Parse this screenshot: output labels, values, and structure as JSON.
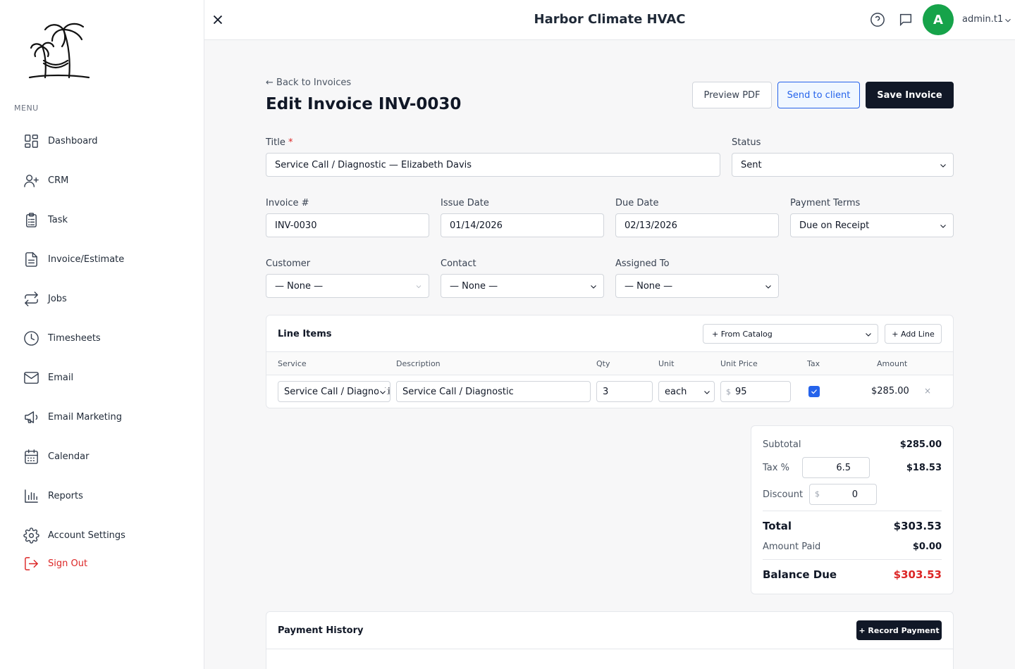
{
  "app": {
    "title": "Harbor Climate HVAC"
  },
  "user": {
    "initial": "A",
    "name": "admin.t1"
  },
  "sidebar": {
    "menu_label": "MENU",
    "items": [
      {
        "label": "Dashboard",
        "icon": "grid-icon"
      },
      {
        "label": "CRM",
        "icon": "user-plus-icon"
      },
      {
        "label": "Task",
        "icon": "clipboard-icon"
      },
      {
        "label": "Invoice/Estimate",
        "icon": "document-icon"
      },
      {
        "label": "Jobs",
        "icon": "repeat-arrows-icon"
      },
      {
        "label": "Timesheets",
        "icon": "clock-icon"
      },
      {
        "label": "Email",
        "icon": "envelope-icon"
      },
      {
        "label": "Email Marketing",
        "icon": "megaphone-icon"
      },
      {
        "label": "Calendar",
        "icon": "calendar-icon"
      },
      {
        "label": "Reports",
        "icon": "bar-chart-icon"
      },
      {
        "label": "Account Settings",
        "icon": "gear-icon"
      }
    ],
    "sign_out": "Sign Out"
  },
  "header": {
    "back_link": "← Back to Invoices",
    "page_title": "Edit Invoice INV-0030",
    "preview_pdf": "Preview PDF",
    "send_to_client": "Send to client",
    "save_invoice": "Save Invoice"
  },
  "form": {
    "title_label": "Title",
    "title_required": "*",
    "title_value": "Service Call / Diagnostic — Elizabeth Davis",
    "status_label": "Status",
    "status_value": "Sent",
    "invoice_no_label": "Invoice #",
    "invoice_no_value": "INV-0030",
    "issue_date_label": "Issue Date",
    "issue_date_value": "01/14/2026",
    "due_date_label": "Due Date",
    "due_date_value": "02/13/2026",
    "payment_terms_label": "Payment Terms",
    "payment_terms_value": "Due on Receipt",
    "customer_label": "Customer",
    "customer_value": "— None —",
    "contact_label": "Contact",
    "contact_value": "— None —",
    "assigned_label": "Assigned To",
    "assigned_value": "— None —"
  },
  "line_items": {
    "title": "Line Items",
    "from_catalog": "+ From Catalog",
    "add_line": "+ Add Line",
    "columns": [
      "Service",
      "Description",
      "Qty",
      "Unit",
      "Unit Price",
      "Tax",
      "Amount"
    ],
    "rows": [
      {
        "service": "Service Call / Diagnostic",
        "description": "Service Call / Diagnostic",
        "qty": "3",
        "unit": "each",
        "currency": "$",
        "unit_price": "95",
        "tax": true,
        "amount": "$285.00",
        "remove": "×"
      }
    ]
  },
  "totals": {
    "subtotal_label": "Subtotal",
    "subtotal_value": "$285.00",
    "tax_label": "Tax %",
    "tax_rate": "6.5",
    "tax_value": "$18.53",
    "discount_label": "Discount",
    "discount_currency": "$",
    "discount_value": "0",
    "total_label": "Total",
    "total_value": "$303.53",
    "amount_paid_label": "Amount Paid",
    "amount_paid_value": "$0.00",
    "balance_due_label": "Balance Due",
    "balance_due_value": "$303.53",
    "balance_color": "#dc2626"
  },
  "payment_history": {
    "title": "Payment History",
    "record_payment": "+ Record Payment"
  }
}
